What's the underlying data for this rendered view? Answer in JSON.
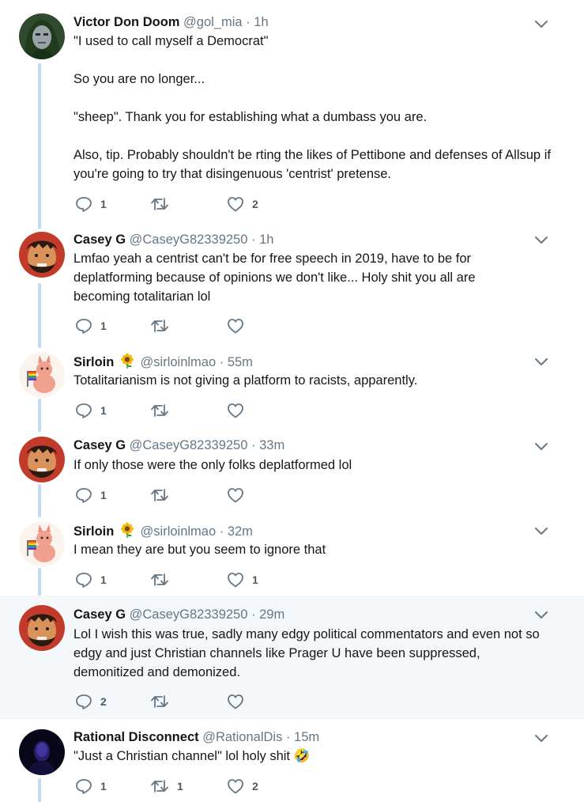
{
  "tweets": [
    {
      "name": "Victor Don Doom",
      "handle": "@gol_mia",
      "time": "1h",
      "paragraphs": [
        "\"I used to call myself a Democrat\"",
        "So you are no longer...",
        "\"sheep\". Thank you for establishing what a dumbass you are.",
        "Also, tip. Probably shouldn't be rting the likes of Pettibone and defenses of Allsup if you're going to try that disingenuous 'centrist' pretense."
      ],
      "reply_count": "1",
      "retweet_count": "",
      "like_count": "2"
    },
    {
      "name": "Casey G",
      "handle": "@CaseyG82339250",
      "time": "1h",
      "paragraphs": [
        "Lmfao yeah a centrist can't be for free speech in 2019, have to be for deplatforming because of opinions we don't like... Holy shit you all are becoming totalitarian lol"
      ],
      "reply_count": "1",
      "retweet_count": "",
      "like_count": ""
    },
    {
      "name": "Sirloin",
      "name_emoji": "sunflower-emoji",
      "handle": "@sirloinlmao",
      "time": "55m",
      "paragraphs": [
        "Totalitarianism is not giving a platform to racists, apparently."
      ],
      "reply_count": "1",
      "retweet_count": "",
      "like_count": ""
    },
    {
      "name": "Casey G",
      "handle": "@CaseyG82339250",
      "time": "33m",
      "paragraphs": [
        "If only those were the only folks deplatformed lol"
      ],
      "reply_count": "1",
      "retweet_count": "",
      "like_count": ""
    },
    {
      "name": "Sirloin",
      "name_emoji": "sunflower-emoji",
      "handle": "@sirloinlmao",
      "time": "32m",
      "paragraphs": [
        "I mean they are but you seem to ignore that"
      ],
      "reply_count": "1",
      "retweet_count": "",
      "like_count": "1"
    },
    {
      "name": "Casey G",
      "handle": "@CaseyG82339250",
      "time": "29m",
      "paragraphs": [
        "Lol I wish this was true, sadly many edgy political commentators and even not so edgy and just Christian channels like Prager U have been suppressed, demonitized and demonized."
      ],
      "reply_count": "2",
      "retweet_count": "",
      "like_count": ""
    },
    {
      "name": "Rational Disconnect",
      "handle": "@RationalDis",
      "time": "15m",
      "paragraphs": [
        "\"Just a Christian channel\" lol holy shit 🤣"
      ],
      "reply_count": "1",
      "retweet_count": "1",
      "like_count": "2"
    }
  ],
  "separator": "·",
  "colors": {
    "thread_line": "#c4dbef",
    "highlight_bg": "#f5f8fa",
    "secondary_text": "#657786",
    "icon_gray": "#657786"
  },
  "icons": [
    "reply-icon",
    "retweet-icon",
    "like-icon",
    "chevron-down-icon",
    "sunflower-emoji"
  ]
}
